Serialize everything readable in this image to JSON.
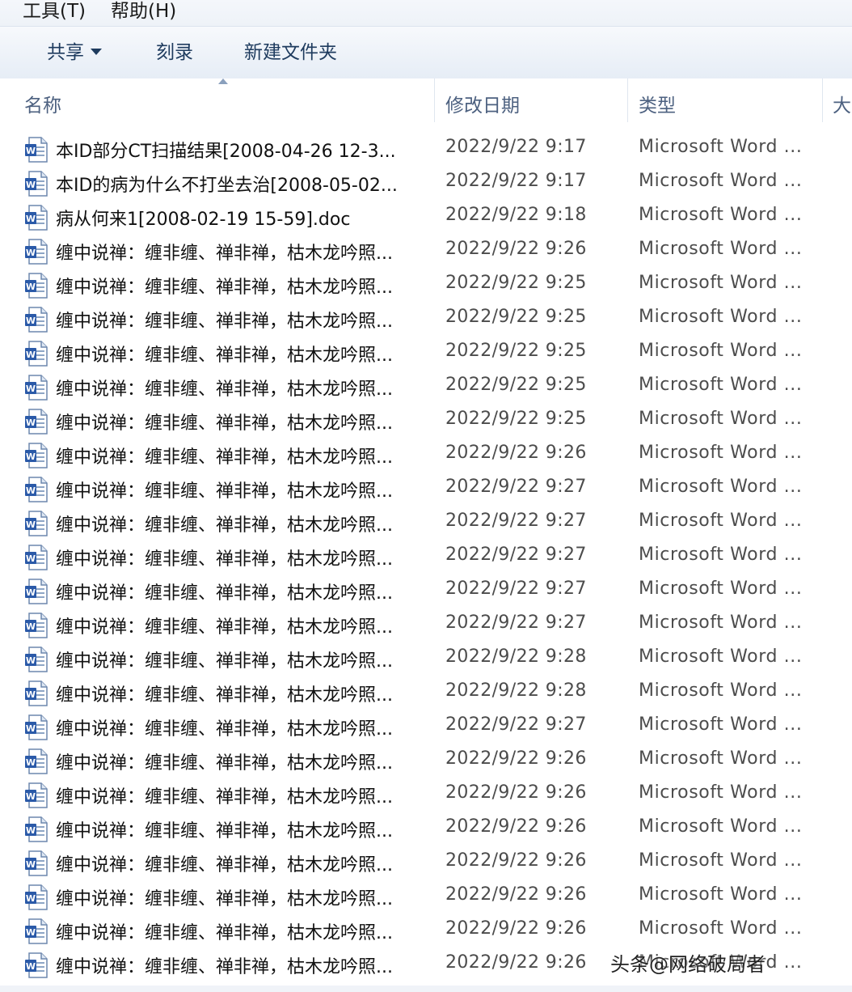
{
  "menubar": {
    "tools": "工具(T)",
    "help": "帮助(H)"
  },
  "toolbar": {
    "share": "共享",
    "burn": "刻录",
    "new_folder": "新建文件夹"
  },
  "columns": {
    "name": "名称",
    "modified": "修改日期",
    "type": "类型",
    "size": "大"
  },
  "files": [
    {
      "name": "本ID部分CT扫描结果[2008-04-26 12-3...",
      "date": "2022/9/22 9:17",
      "type": "Microsoft Word ..."
    },
    {
      "name": "本ID的病为什么不打坐去治[2008-05-02...",
      "date": "2022/9/22 9:17",
      "type": "Microsoft Word ..."
    },
    {
      "name": "病从何来1[2008-02-19 15-59].doc",
      "date": "2022/9/22 9:18",
      "type": "Microsoft Word ..."
    },
    {
      "name": "缠中说禅：缠非缠、禅非禅，枯木龙吟照...",
      "date": "2022/9/22 9:26",
      "type": "Microsoft Word ..."
    },
    {
      "name": "缠中说禅：缠非缠、禅非禅，枯木龙吟照...",
      "date": "2022/9/22 9:25",
      "type": "Microsoft Word ..."
    },
    {
      "name": "缠中说禅：缠非缠、禅非禅，枯木龙吟照...",
      "date": "2022/9/22 9:25",
      "type": "Microsoft Word ..."
    },
    {
      "name": "缠中说禅：缠非缠、禅非禅，枯木龙吟照...",
      "date": "2022/9/22 9:25",
      "type": "Microsoft Word ..."
    },
    {
      "name": "缠中说禅：缠非缠、禅非禅，枯木龙吟照...",
      "date": "2022/9/22 9:25",
      "type": "Microsoft Word ..."
    },
    {
      "name": "缠中说禅：缠非缠、禅非禅，枯木龙吟照...",
      "date": "2022/9/22 9:25",
      "type": "Microsoft Word ..."
    },
    {
      "name": "缠中说禅：缠非缠、禅非禅，枯木龙吟照...",
      "date": "2022/9/22 9:26",
      "type": "Microsoft Word ..."
    },
    {
      "name": "缠中说禅：缠非缠、禅非禅，枯木龙吟照...",
      "date": "2022/9/22 9:27",
      "type": "Microsoft Word ..."
    },
    {
      "name": "缠中说禅：缠非缠、禅非禅，枯木龙吟照...",
      "date": "2022/9/22 9:27",
      "type": "Microsoft Word ..."
    },
    {
      "name": "缠中说禅：缠非缠、禅非禅，枯木龙吟照...",
      "date": "2022/9/22 9:27",
      "type": "Microsoft Word ..."
    },
    {
      "name": "缠中说禅：缠非缠、禅非禅，枯木龙吟照...",
      "date": "2022/9/22 9:27",
      "type": "Microsoft Word ..."
    },
    {
      "name": "缠中说禅：缠非缠、禅非禅，枯木龙吟照...",
      "date": "2022/9/22 9:27",
      "type": "Microsoft Word ..."
    },
    {
      "name": "缠中说禅：缠非缠、禅非禅，枯木龙吟照...",
      "date": "2022/9/22 9:28",
      "type": "Microsoft Word ..."
    },
    {
      "name": "缠中说禅：缠非缠、禅非禅，枯木龙吟照...",
      "date": "2022/9/22 9:28",
      "type": "Microsoft Word ..."
    },
    {
      "name": "缠中说禅：缠非缠、禅非禅，枯木龙吟照...",
      "date": "2022/9/22 9:27",
      "type": "Microsoft Word ..."
    },
    {
      "name": "缠中说禅：缠非缠、禅非禅，枯木龙吟照...",
      "date": "2022/9/22 9:26",
      "type": "Microsoft Word ..."
    },
    {
      "name": "缠中说禅：缠非缠、禅非禅，枯木龙吟照...",
      "date": "2022/9/22 9:26",
      "type": "Microsoft Word ..."
    },
    {
      "name": "缠中说禅：缠非缠、禅非禅，枯木龙吟照...",
      "date": "2022/9/22 9:26",
      "type": "Microsoft Word ..."
    },
    {
      "name": "缠中说禅：缠非缠、禅非禅，枯木龙吟照...",
      "date": "2022/9/22 9:26",
      "type": "Microsoft Word ..."
    },
    {
      "name": "缠中说禅：缠非缠、禅非禅，枯木龙吟照...",
      "date": "2022/9/22 9:26",
      "type": "Microsoft Word ..."
    },
    {
      "name": "缠中说禅：缠非缠、禅非禅，枯木龙吟照...",
      "date": "2022/9/22 9:26",
      "type": "Microsoft Word ..."
    },
    {
      "name": "缠中说禅：缠非缠、禅非禅，枯木龙吟照...",
      "date": "2022/9/22 9:26",
      "type": "Microsoft Word ..."
    }
  ],
  "file_icon": "word-document-icon",
  "watermark": "头条@网络破局者"
}
